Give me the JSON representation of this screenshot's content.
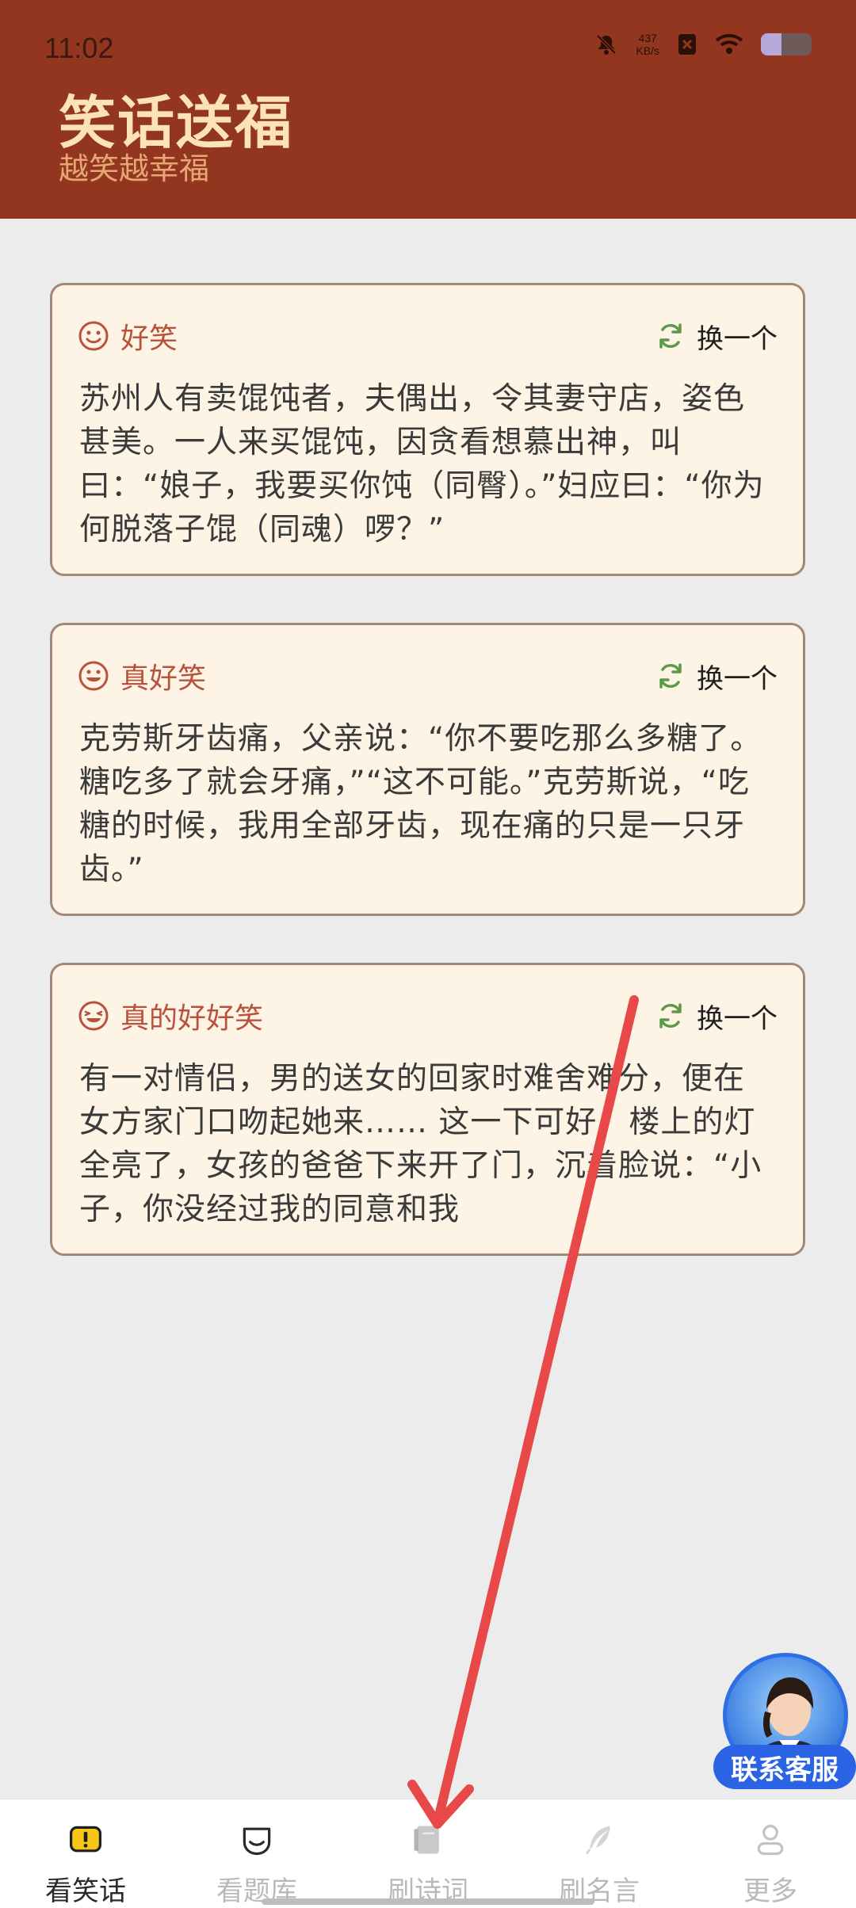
{
  "status_bar": {
    "time": "11:02",
    "net_speed_value": "437",
    "net_speed_unit": "KB/s"
  },
  "header": {
    "title": "笑话送福",
    "subtitle": "越笑越幸福"
  },
  "cards": [
    {
      "tag": "好笑",
      "tag_icon": "smile-icon",
      "refresh_label": "换一个",
      "text": "苏州人有卖馄饨者，夫偶出，令其妻守店，姿色甚美。一人来买馄饨，因贪看想慕出神，叫曰：“娘子，我要买你饨（同臀）。”妇应曰：“你为何脱落子馄（同魂）啰？”"
    },
    {
      "tag": "真好笑",
      "tag_icon": "grin-icon",
      "refresh_label": "换一个",
      "text": "克劳斯牙齿痛，父亲说：“你不要吃那么多糖了。糖吃多了就会牙痛，”“这不可能。”克劳斯说，“吃糖的时候，我用全部牙齿，现在痛的只是一只牙齿。”"
    },
    {
      "tag": "真的好好笑",
      "tag_icon": "laugh-icon",
      "refresh_label": "换一个",
      "text": "有一对情侣，男的送女的回家时难舍难分，便在女方家门口吻起她来…… 这一下可好，楼上的灯全亮了，女孩的爸爸下来开了门，沉着脸说：“小子，你没经过我的同意和我"
    }
  ],
  "service": {
    "label": "联系客服"
  },
  "nav": [
    {
      "label": "看笑话",
      "icon": "joke-icon",
      "active": true
    },
    {
      "label": "看题库",
      "icon": "quiz-icon",
      "active": false
    },
    {
      "label": "刷诗词",
      "icon": "poetry-book-icon",
      "active": false
    },
    {
      "label": "刷名言",
      "icon": "quill-icon",
      "active": false
    },
    {
      "label": "更多",
      "icon": "person-icon",
      "active": false
    }
  ],
  "colors": {
    "header_bg": "#93361f",
    "title": "#fbe2b7",
    "subtitle": "#e7a774",
    "card_bg": "#fdf4e6",
    "card_border": "#a48877",
    "tag_text": "#b7533d",
    "refresh_icon": "#5c9a4a",
    "annotation_arrow": "#e84848",
    "service_blue": "#2a63e4"
  }
}
